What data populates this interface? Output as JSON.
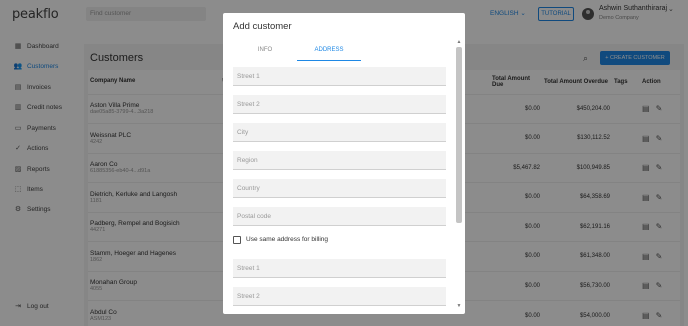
{
  "app": {
    "logo": "peakflo"
  },
  "topbar": {
    "search_placeholder": "Find customer",
    "language": "ENGLISH",
    "tutorial_label": "TUTORIAL",
    "user_name": "Ashwin Suthanthiraraj",
    "user_company": "Demo Company"
  },
  "sidebar": {
    "items": [
      {
        "label": "Dashboard",
        "icon": "grid-icon"
      },
      {
        "label": "Customers",
        "icon": "users-icon",
        "active": true
      },
      {
        "label": "Invoices",
        "icon": "document-icon"
      },
      {
        "label": "Credit notes",
        "icon": "credit-note-icon"
      },
      {
        "label": "Payments",
        "icon": "card-icon"
      },
      {
        "label": "Actions",
        "icon": "check-circle-icon"
      },
      {
        "label": "Reports",
        "icon": "chart-icon"
      },
      {
        "label": "Items",
        "icon": "box-icon"
      },
      {
        "label": "Settings",
        "icon": "gear-icon"
      }
    ],
    "logout_label": "Log out"
  },
  "main": {
    "title": "Customers",
    "create_button": "CREATE CUSTOMER",
    "columns": {
      "company_name": "Company Name",
      "total_amount_due": "Total Amount Due",
      "total_amount_overdue": "Total Amount Overdue",
      "tags": "Tags",
      "action": "Action"
    },
    "rows": [
      {
        "name": "Aston Villa Prime",
        "id": "dae05a85-3799-4...3a218",
        "due": "$0.00",
        "overdue": "$450,204.00"
      },
      {
        "name": "Weissnat PLC",
        "id": "4242",
        "due": "$0.00",
        "overdue": "$130,112.52"
      },
      {
        "name": "Aaron Co",
        "id": "61885356-eb40-4...d91a",
        "due": "$5,467.82",
        "overdue": "$100,949.85"
      },
      {
        "name": "Dietrich, Kerluke and Langosh",
        "id": "1181",
        "due": "$0.00",
        "overdue": "$64,358.69"
      },
      {
        "name": "Padberg, Rempel and Bogisich",
        "id": "44271",
        "due": "$0.00",
        "overdue": "$62,191.16"
      },
      {
        "name": "Stamm, Hoeger and Hagenes",
        "id": "1862",
        "due": "$0.00",
        "overdue": "$61,348.00"
      },
      {
        "name": "Monahan Group",
        "id": "4055",
        "due": "$0.00",
        "overdue": "$56,730.00"
      },
      {
        "name": "Abdul Co",
        "id": "ASM123",
        "due": "$0.00",
        "overdue": "$54,000.00"
      }
    ]
  },
  "modal": {
    "title": "Add customer",
    "tabs": [
      {
        "label": "INFO"
      },
      {
        "label": "ADDRESS",
        "active": true
      }
    ],
    "fields": {
      "street1": "Street 1",
      "street2": "Street 2",
      "city": "City",
      "region": "Region",
      "country": "Country",
      "postal_code": "Postal code"
    },
    "same_address_label": "Use same address for billing",
    "billing_fields": {
      "street1": "Street 1",
      "street2": "Street 2"
    }
  },
  "colors": {
    "accent": "#1e88e5",
    "overlay": "rgba(0,0,0,0.45)"
  }
}
